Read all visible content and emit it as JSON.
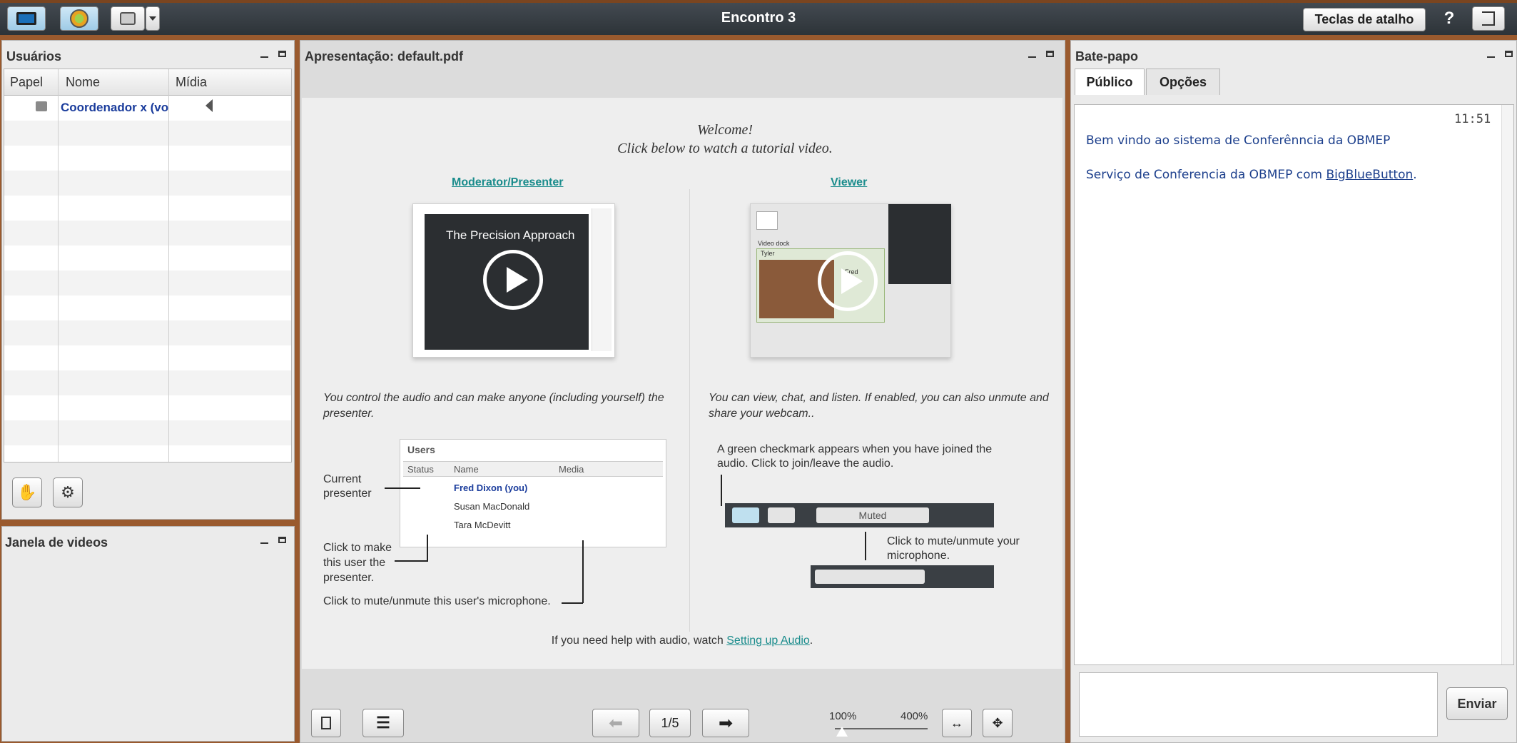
{
  "app": {
    "title": "Encontro 3",
    "shortcuts_label": "Teclas de atalho",
    "help_label": "?"
  },
  "users_panel": {
    "title": "Usuários",
    "columns": [
      "Papel",
      "Nome",
      "Mídia"
    ],
    "rows": [
      {
        "name": "Coordenador x (vo"
      }
    ]
  },
  "videos_panel": {
    "title": "Janela de videos"
  },
  "presentation": {
    "title": "Apresentação: default.pdf",
    "slide": {
      "welcome": "Welcome!",
      "subtitle": "Click below to watch a tutorial video.",
      "moderator_link": "Moderator/Presenter",
      "viewer_link": "Viewer",
      "thumb_title": "The Precision Approach",
      "moderator_text": "You control the audio and can make anyone (including yourself) the presenter.",
      "viewer_text": "You can view, chat, and listen.  If enabled, you can also unmute and share your webcam..",
      "mini_users": {
        "title": "Users",
        "columns": [
          "Status",
          "Name",
          "Media"
        ],
        "rows": [
          "Fred Dixon (you)",
          "Susan MacDonald",
          "Tara McDevitt"
        ]
      },
      "current_presenter": "Current presenter",
      "click_make_presenter": "Click to make this user the presenter.",
      "click_mute_user": "Click to mute/unmute this user's microphone.",
      "green_check": "A green checkmark appears when you have joined the audio.  Click to join/leave the audio.",
      "muted_label": "Muted",
      "click_mute_mic": "Click to mute/unmute your microphone.",
      "help_prefix": "If you need help with audio, watch ",
      "help_link": "Setting up Audio",
      "help_suffix": ".",
      "video_dock": "Video dock",
      "tyler": "Tyler",
      "fred": "Fred"
    },
    "page_indicator": "1/5",
    "zoom_min": "100%",
    "zoom_max": "400%"
  },
  "chat_panel": {
    "title": "Bate-papo",
    "tabs": [
      "Público",
      "Opções"
    ],
    "time": "11:51",
    "messages": [
      "Bem vindo ao sistema de Conferênncia da OBMEP"
    ],
    "msg2_prefix": "Serviço de Conferencia da OBMEP com ",
    "msg2_link": "BigBlueButton",
    "msg2_suffix": ".",
    "send_label": "Enviar",
    "input_value": ""
  }
}
